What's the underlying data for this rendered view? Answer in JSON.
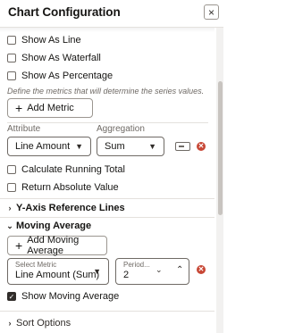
{
  "header": {
    "title": "Chart Configuration",
    "close_label": "×"
  },
  "checkboxes": {
    "show_as_line": "Show As Line",
    "show_as_waterfall": "Show As Waterfall",
    "show_as_percentage": "Show As Percentage"
  },
  "metrics_hint": "Define the metrics that will determine the series values.",
  "add_metric_label": "Add Metric",
  "columns": {
    "attribute": "Attribute",
    "aggregation": "Aggregation"
  },
  "metric_row": {
    "attribute_value": "Line Amount",
    "aggregation_value": "Sum"
  },
  "options": {
    "calculate_running_total": "Calculate Running Total",
    "return_absolute_value": "Return Absolute Value"
  },
  "sections": {
    "y_axis_reference_lines": "Y-Axis Reference Lines",
    "moving_average": "Moving Average",
    "sort_options": "Sort Options"
  },
  "moving_average": {
    "add_label": "Add Moving Average",
    "select_metric_label": "Select Metric",
    "select_metric_value": "Line Amount (Sum)",
    "period_label": "Period...",
    "period_value": "2",
    "show_label": "Show Moving Average",
    "show_checked": true
  },
  "colors": {
    "accent_remove": "#c74634",
    "text": "#161513",
    "muted": "#6f6a65"
  }
}
